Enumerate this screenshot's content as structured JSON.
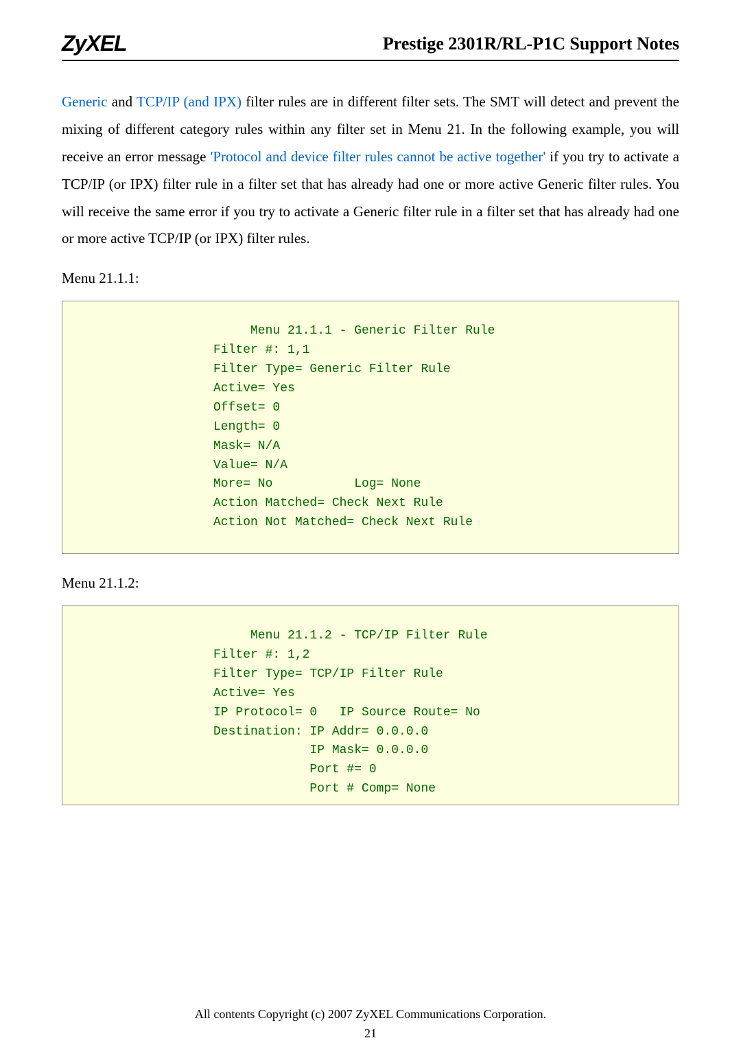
{
  "header": {
    "logo": "ZyXEL",
    "title": "Prestige 2301R/RL-P1C Support Notes"
  },
  "paragraph": {
    "span1": "Generic",
    "span2": " and ",
    "span3": "TCP/IP (and IPX)",
    "span4": " filter rules are in different filter sets. The SMT will detect and prevent the mixing of different category rules within any filter set in Menu 21. In the following example, you will receive an error message ",
    "span5": "'Protocol and device filter rules cannot be active together'",
    "span6": " if you try to activate a TCP/IP (or IPX) filter rule in a filter set that has already had one or more active Generic filter rules. You will receive the same error if you try to activate a Generic filter rule in a filter set that has already had one or more active TCP/IP (or IPX) filter rules."
  },
  "menu1_label": "Menu 21.1.1:",
  "code1": "     Menu 21.1.1 - Generic Filter Rule\nFilter #: 1,1\nFilter Type= Generic Filter Rule\nActive= Yes\nOffset= 0\nLength= 0\nMask= N/A\nValue= N/A\nMore= No           Log= None\nAction Matched= Check Next Rule\nAction Not Matched= Check Next Rule",
  "menu2_label": "Menu 21.1.2:",
  "code2": "     Menu 21.1.2 - TCP/IP Filter Rule\nFilter #: 1,2\nFilter Type= TCP/IP Filter Rule\nActive= Yes\nIP Protocol= 0   IP Source Route= No\nDestination: IP Addr= 0.0.0.0\n             IP Mask= 0.0.0.0\n             Port #= 0\n             Port # Comp= None",
  "footer": "All contents Copyright (c) 2007 ZyXEL Communications Corporation.",
  "page": "21"
}
